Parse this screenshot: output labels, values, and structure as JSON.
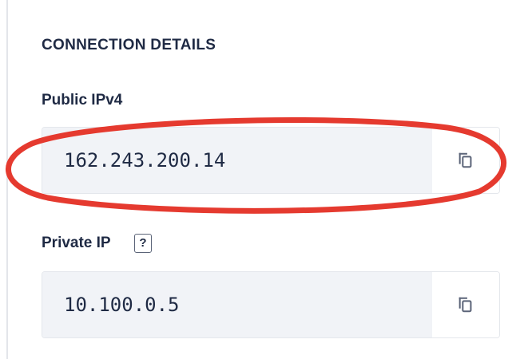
{
  "section": {
    "title": "CONNECTION DETAILS"
  },
  "public_ip": {
    "label": "Public IPv4",
    "value": "162.243.200.14",
    "copy_icon": "copy-icon"
  },
  "private_ip": {
    "label": "Private IP",
    "help_glyph": "?",
    "value": "10.100.0.5",
    "copy_icon": "copy-icon"
  },
  "colors": {
    "text": "#1f2a44",
    "field_background": "#f1f3f7",
    "annotation": "#e53a2f"
  }
}
